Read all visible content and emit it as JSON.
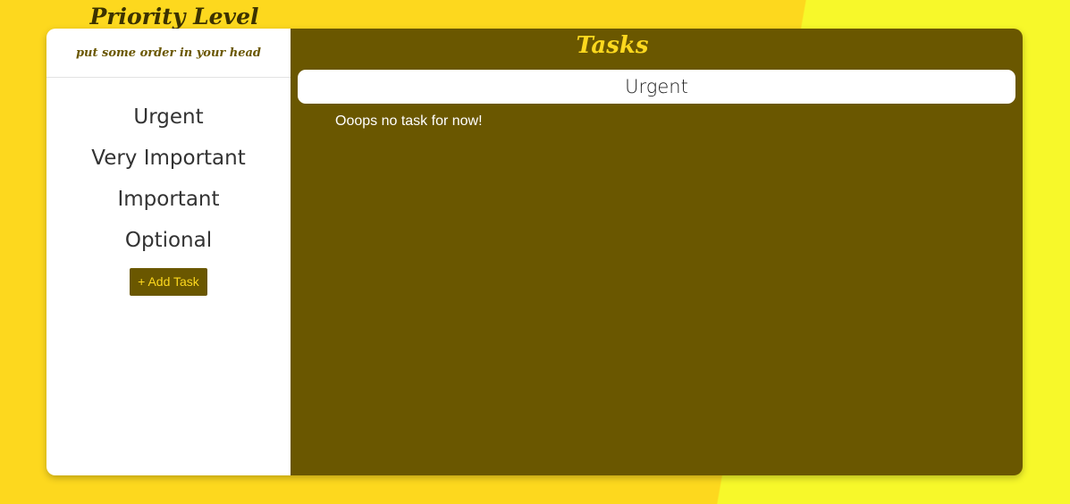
{
  "app": {
    "title": "Priority Level",
    "tagline": "put some order in your head"
  },
  "sidebar": {
    "items": [
      {
        "label": "Urgent"
      },
      {
        "label": "Very Important"
      },
      {
        "label": "Important"
      },
      {
        "label": "Optional"
      }
    ],
    "add_button_label": "+ Add Task"
  },
  "main": {
    "title": "Tasks",
    "selected_category": "Urgent",
    "empty_message": "Ooops no task for now!"
  },
  "colors": {
    "background_yellow": "#fdd81e",
    "background_light": "#f7f82a",
    "panel_olive": "#6a5700",
    "accent_yellow": "#fdd81e",
    "white": "#ffffff"
  }
}
